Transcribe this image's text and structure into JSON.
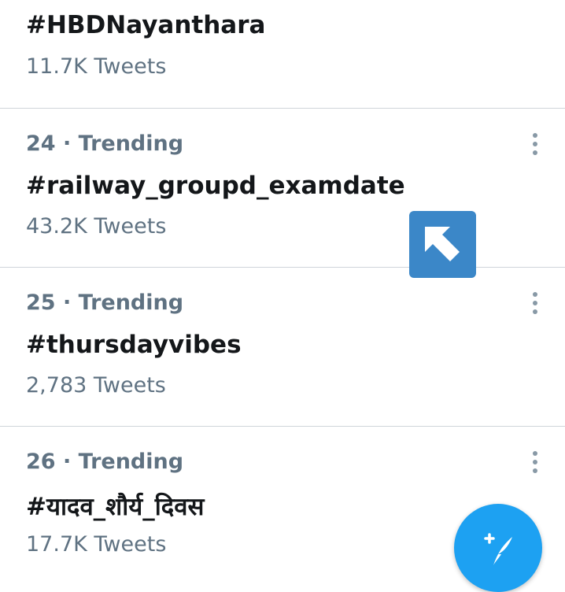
{
  "trends": [
    {
      "meta": "",
      "title": "#HBDNayanthara",
      "count": "11.7K Tweets"
    },
    {
      "meta": "24 · Trending",
      "title": "#railway_groupd_examdate",
      "count": "43.2K Tweets"
    },
    {
      "meta": "25 · Trending",
      "title": "#thursdayvibes",
      "count": "2,783 Tweets"
    },
    {
      "meta": "26 · Trending",
      "title": "#यादव_शौर्य_दिवस",
      "count": "17.7K Tweets"
    }
  ],
  "icons": {
    "more": "more-vertical-icon",
    "cursor": "arrow-up-left-icon",
    "compose": "compose-tweet-icon"
  },
  "colors": {
    "accent": "#1da1f2",
    "meta_text": "#5f7282",
    "title_text": "#14171a",
    "divider": "#cfd5da",
    "cursor_overlay": "#3b87c8"
  }
}
